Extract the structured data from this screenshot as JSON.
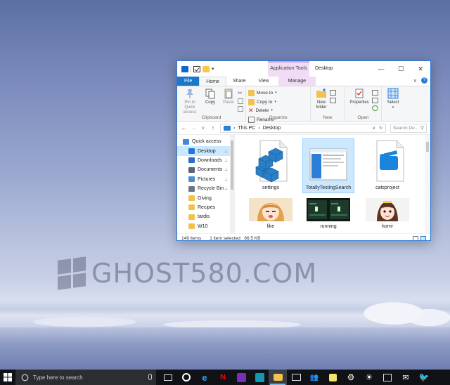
{
  "window": {
    "title": "Desktop",
    "context_tab": "Application Tools",
    "controls": {
      "minimize": "—",
      "maximize": "☐",
      "close": "✕"
    }
  },
  "ribbon": {
    "tabs": [
      "File",
      "Home",
      "Share",
      "View",
      "Manage"
    ],
    "expand": "∨",
    "help": "?",
    "clipboard": {
      "label": "Clipboard",
      "pin": "Pin to Quick access",
      "copy": "Copy",
      "paste": "Paste"
    },
    "organize": {
      "label": "Organize",
      "move_to": "Move to",
      "copy_to": "Copy to",
      "delete": "Delete",
      "rename": "Rename"
    },
    "new": {
      "label": "New",
      "new_folder": "New folder"
    },
    "open": {
      "label": "Open",
      "properties": "Properties"
    },
    "select": {
      "label": "Select"
    }
  },
  "address": {
    "back": "←",
    "forward": "→",
    "recent": "∨",
    "up": "↑",
    "path": [
      "This PC",
      "Desktop"
    ],
    "separator": "›",
    "dropdown": "∨",
    "refresh": "↻",
    "search_placeholder": "Search De..."
  },
  "nav_pane": {
    "items": [
      {
        "label": "Quick access",
        "pinned": false,
        "selected": false,
        "color": "#3c8ad8"
      },
      {
        "label": "Desktop",
        "pinned": true,
        "selected": true,
        "color": "#1e78d4"
      },
      {
        "label": "Downloads",
        "pinned": true,
        "selected": false,
        "color": "#2b6cc4"
      },
      {
        "label": "Documents",
        "pinned": true,
        "selected": false,
        "color": "#5a6475"
      },
      {
        "label": "Pictures",
        "pinned": true,
        "selected": false,
        "color": "#4a8ed0"
      },
      {
        "label": "Recycle Bin",
        "pinned": true,
        "selected": false,
        "color": "#6e7681"
      },
      {
        "label": "Giving",
        "pinned": false,
        "selected": false,
        "color": "#f1c24f"
      },
      {
        "label": "Recipes",
        "pinned": false,
        "selected": false,
        "color": "#f1c24f"
      },
      {
        "label": "tardis",
        "pinned": false,
        "selected": false,
        "color": "#f1c24f"
      },
      {
        "label": "W10",
        "pinned": false,
        "selected": false,
        "color": "#f1c24f"
      }
    ],
    "pin_glyph": "📌"
  },
  "files": [
    {
      "name": "settings",
      "selected": false
    },
    {
      "name": "TotallyTestingSearch",
      "selected": true
    },
    {
      "name": "catsproject",
      "selected": false
    },
    {
      "name": "like",
      "selected": false
    },
    {
      "name": "running",
      "selected": false
    },
    {
      "name": "horrir",
      "selected": false
    }
  ],
  "status": {
    "count": "149 items",
    "selection": "1 item selected",
    "size": "66.5 KB"
  },
  "watermark": "GHOST580.COM",
  "taskbar": {
    "search_placeholder": "Type here to search",
    "icons": [
      "task-view",
      "groove",
      "edge",
      "netflix",
      "onenote",
      "camera",
      "file-explorer",
      "photos",
      "people",
      "sticky-notes",
      "settings",
      "weather",
      "calendar",
      "mail",
      "twitter"
    ]
  }
}
